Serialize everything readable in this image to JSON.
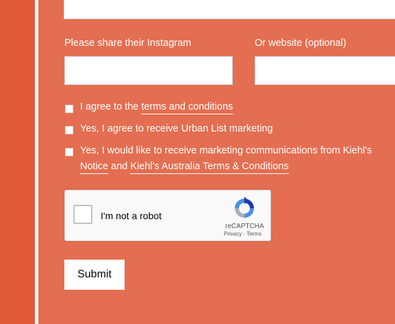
{
  "form": {
    "instagram_label": "Please share their Instagram",
    "instagram_value": "",
    "website_label": "Or website (optional)",
    "website_value": ""
  },
  "consents": {
    "terms_prefix": "I agree to the ",
    "terms_link": "terms and conditions",
    "marketing_label": "Yes, I agree to receive Urban List marketing",
    "kiehls_text": "Yes, I would like to receive marketing communications from Kiehl's",
    "notice_link": "Notice",
    "and_text": " and ",
    "kiehls_terms_link": "Kiehl's Australia Terms & Conditions"
  },
  "captcha": {
    "label": "I'm not a robot",
    "brand": "reCAPTCHA",
    "links": "Privacy - Terms"
  },
  "submit_label": "Submit"
}
